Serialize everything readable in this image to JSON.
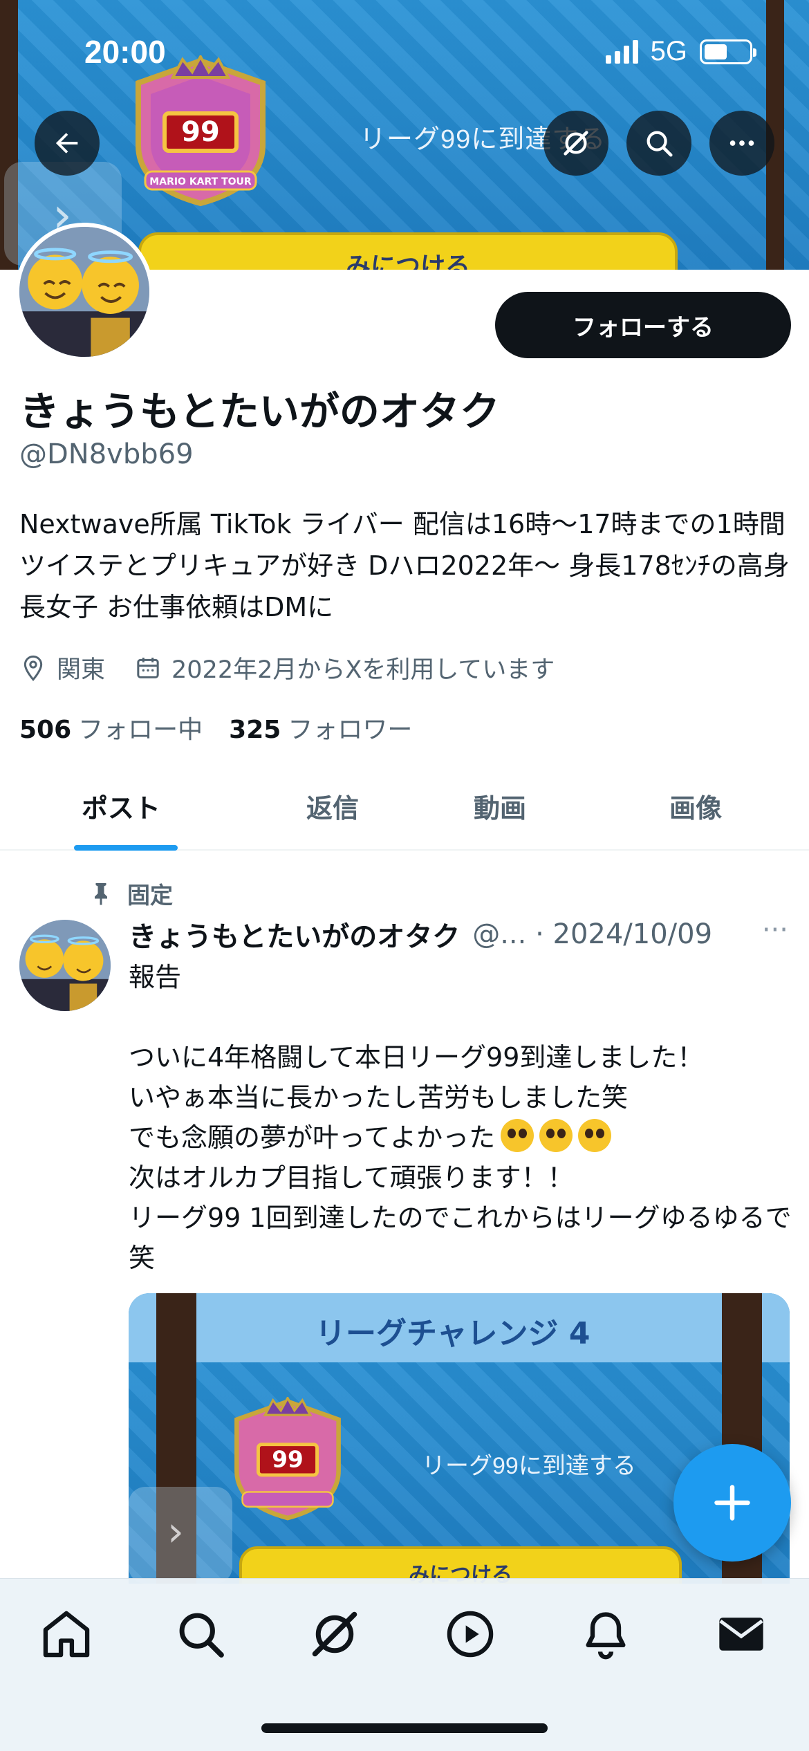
{
  "status_bar": {
    "time": "20:00",
    "network": "5G"
  },
  "banner": {
    "league_text": "リーグ99に到達する",
    "yellow_button_text": "みにつける",
    "badge_number": "99",
    "badge_caption": "MARIO KART TOUR"
  },
  "header": {
    "back_icon": "arrow-left-icon",
    "grok_icon": "grok-icon",
    "search_icon": "search-icon",
    "more_icon": "more-icon"
  },
  "profile": {
    "display_name": "きょうもとたいがのオタク",
    "handle": "@DN8vbb69",
    "follow_label": "フォローする",
    "bio": "Nextwave所属 TikTok ライバー 配信は16時〜17時までの1時間 ツイステとプリキュアが好き Dハロ2022年〜 身長178ｾﾝﾁの高身長女子 お仕事依頼はDMに",
    "location": "関東",
    "joined": "2022年2月からXを利用しています",
    "following_count": "506",
    "following_label": "フォロー中",
    "followers_count": "325",
    "followers_label": "フォロワー"
  },
  "tabs": [
    {
      "label": "ポスト",
      "active": true
    },
    {
      "label": "返信",
      "active": false
    },
    {
      "label": "動画",
      "active": false
    },
    {
      "label": "画像",
      "active": false
    }
  ],
  "post": {
    "pinned_label": "固定",
    "author_name": "きょうもとたいがのオタク",
    "author_handle_date": "@... · 2024/10/09",
    "more": "···",
    "text_before_emoji": "報告\n\nついに4年格闘して本日リーグ99到達しました！\nいやぁ本当に長かったし苦労もしました笑\nでも念願の夢が叶ってよかった",
    "text_after_emoji": "\n次はオルカプ目指して頑張ります！！\nリーグ99  1回到達したのでこれからはリーグゆるゆるで笑",
    "media": {
      "title": "リーグチャレンジ 4",
      "league_text": "リーグ99に到達する",
      "yellow_button_text": "みにつける",
      "badge_number": "99"
    }
  },
  "fab": {
    "icon": "plus-icon"
  },
  "bottom_nav": [
    {
      "name": "home-icon"
    },
    {
      "name": "search-icon"
    },
    {
      "name": "grok-icon"
    },
    {
      "name": "play-icon"
    },
    {
      "name": "bell-icon"
    },
    {
      "name": "mail-icon"
    }
  ],
  "colors": {
    "accent": "#1d9bf0",
    "text": "#0f1419",
    "secondary_text": "#536471",
    "banner_blue": "#2b93d6",
    "badge_yellow": "#f2d21a"
  }
}
